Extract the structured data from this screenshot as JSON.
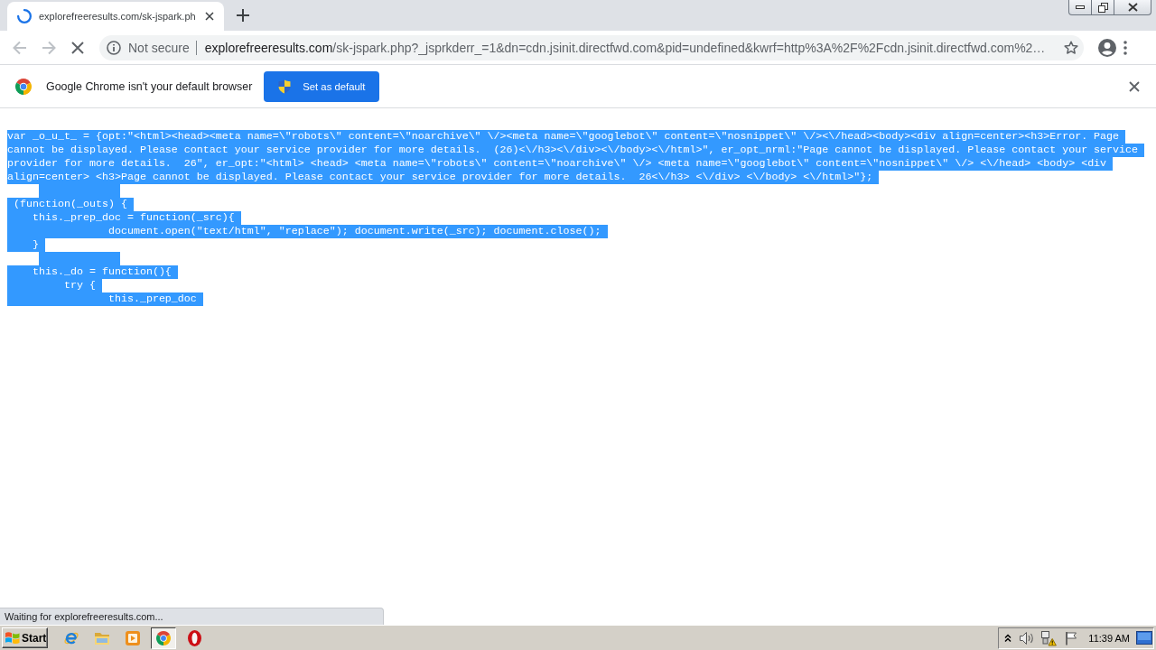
{
  "browser": {
    "tab": {
      "title": "explorefreeresults.com/sk-jspark.ph",
      "loading": true
    },
    "nav_buttons": [
      {
        "kind": "back",
        "disabled": true
      },
      {
        "kind": "forward",
        "disabled": true
      },
      {
        "kind": "stop",
        "disabled": false
      }
    ],
    "address_bar": {
      "security": "Not secure",
      "host": "explorefreeresults.com",
      "path": "/sk-jspark.php?_jsprkderr_=1&dn=cdn.jsinit.directfwd.com&pid=undefined&kwrf=http%3A%2F%2Fcdn.jsinit.directfwd.com%2…",
      "bookmarked": false
    }
  },
  "infobar": {
    "message": "Google Chrome isn't your default browser",
    "button": "Set as default"
  },
  "code": {
    "lines": [
      {
        "kind": "text",
        "selected": true,
        "text": "var _o_u_t_ = {opt:\"<html><head><meta name=\\\"robots\\\" content=\\\"noarchive\\\" \\/><meta name=\\\"googlebot\\\" content=\\\"nosnippet\\\" \\/><\\/head><body><div align=center><h3>Error. Page"
      },
      {
        "kind": "text",
        "selected": true,
        "text": "cannot be displayed. Please contact your service provider for more details.  (26)<\\/h3><\\/div><\\/body><\\/html>\", er_opt_nrml:\"Page cannot be displayed. Please contact your service"
      },
      {
        "kind": "text",
        "selected": true,
        "text": "provider for more details.  26\", er_opt:\"<html> <head> <meta name=\\\"robots\\\" content=\\\"noarchive\\\" \\/> <meta name=\\\"googlebot\\\" content=\\\"nosnippet\\\" \\/> <\\/head> <body> <div"
      },
      {
        "kind": "text",
        "selected": true,
        "text": "align=center> <h3>Page cannot be displayed. Please contact your service provider for more details.  26<\\/h3> <\\/div> <\\/body> <\\/html>\"};"
      },
      {
        "kind": "blank",
        "selected": true
      },
      {
        "kind": "text",
        "selected": true,
        "text": " (function(_outs) {"
      },
      {
        "kind": "text",
        "selected": true,
        "text": "    this._prep_doc = function(_src){"
      },
      {
        "kind": "text",
        "selected": true,
        "text": "                document.open(\"text/html\", \"replace\"); document.write(_src); document.close();"
      },
      {
        "kind": "text",
        "selected": true,
        "text": "    }"
      },
      {
        "kind": "blank",
        "selected": true
      },
      {
        "kind": "text",
        "selected": true,
        "text": "    this._do = function(){"
      },
      {
        "kind": "text",
        "selected": true,
        "text": "         try {"
      },
      {
        "kind": "text",
        "selected": true,
        "text": "                this._prep_doc"
      }
    ]
  },
  "status_bubble": {
    "text": "Waiting for explorefreeresults.com..."
  },
  "taskbar": {
    "start": "Start",
    "apps": [
      {
        "kind": "ie",
        "selected": false
      },
      {
        "kind": "explorer",
        "selected": false
      },
      {
        "kind": "media",
        "selected": false
      },
      {
        "kind": "chrome",
        "selected": true
      },
      {
        "kind": "opera",
        "selected": false
      }
    ],
    "clock": "11:39 AM"
  }
}
